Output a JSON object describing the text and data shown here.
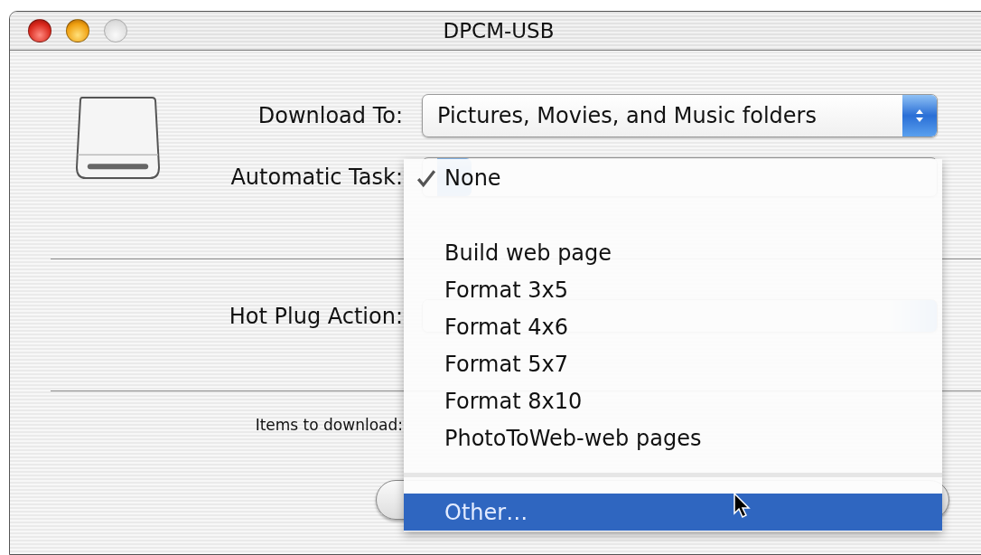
{
  "window": {
    "title": "DPCM-USB",
    "buttons": [
      {
        "kind": "close",
        "disabled": false
      },
      {
        "kind": "minimize",
        "disabled": false
      },
      {
        "kind": "zoom",
        "disabled": true
      }
    ]
  },
  "settings": [
    {
      "label": "Download To:",
      "value": "Pictures, Movies, and Music folders"
    },
    {
      "label": "Automatic Task:"
    }
  ],
  "hot_plug": {
    "label": "Hot Plug Action:"
  },
  "items_to_download": {
    "label": "Items to download:"
  },
  "menu": {
    "items": [
      {
        "kind": "item",
        "label": "None",
        "checked": true,
        "selected": false
      },
      {
        "kind": "item",
        "label": "Build web page",
        "checked": false,
        "selected": false
      },
      {
        "kind": "item",
        "label": "Format 3x5",
        "checked": false,
        "selected": false
      },
      {
        "kind": "item",
        "label": "Format 4x6",
        "checked": false,
        "selected": false
      },
      {
        "kind": "item",
        "label": "Format 5x7",
        "checked": false,
        "selected": false
      },
      {
        "kind": "item",
        "label": "Format 8x10",
        "checked": false,
        "selected": false
      },
      {
        "kind": "item",
        "label": "PhotoToWeb-web pages",
        "checked": false,
        "selected": false
      },
      {
        "kind": "separator"
      },
      {
        "kind": "item",
        "label": "Other…",
        "checked": false,
        "selected": true
      }
    ]
  }
}
